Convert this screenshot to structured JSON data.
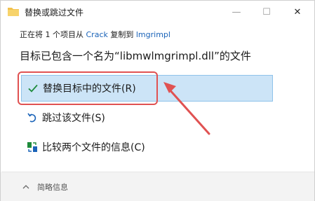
{
  "window": {
    "title": "替换或跳过文件",
    "controls": {
      "minimize": "—",
      "maximize": "☐",
      "close": "✕"
    }
  },
  "source": {
    "prefix": "正在将 1 个项目从 ",
    "from": "Crack",
    "middle": " 复制到 ",
    "to": "lmgrimpl"
  },
  "heading": "目标已包含一个名为“libmwlmgrimpl.dll”的文件",
  "options": {
    "replace": {
      "label": "替换目标中的文件(R)",
      "icon": "check-icon"
    },
    "skip": {
      "label": "跳过该文件(S)",
      "icon": "skip-icon"
    },
    "compare": {
      "label": "比较两个文件的信息(C)",
      "icon": "compare-icon"
    }
  },
  "footer": {
    "details_label": "简略信息",
    "icon": "chevron-up-icon"
  },
  "colors": {
    "selected_bg": "#cce4f7",
    "selected_border": "#8fc3ea",
    "link": "#1a63b8",
    "annotation": "#e05252",
    "check": "#1d8a3a"
  }
}
